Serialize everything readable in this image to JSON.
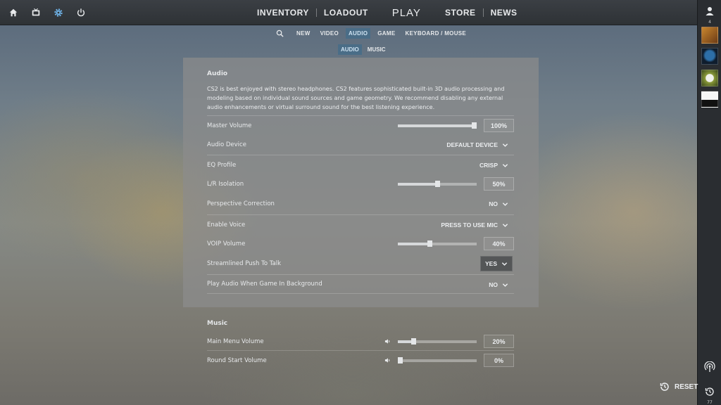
{
  "topbar": {
    "icons": [
      "home-icon",
      "tv-icon",
      "settings-gear-icon",
      "power-icon"
    ],
    "nav": {
      "inventory": "INVENTORY",
      "loadout": "LOADOUT",
      "play": "PLAY",
      "store": "STORE",
      "news": "NEWS"
    }
  },
  "subnav": {
    "tabs": [
      "NEW",
      "VIDEO",
      "AUDIO",
      "GAME",
      "KEYBOARD / MOUSE"
    ],
    "active": "AUDIO",
    "subtabs": [
      "AUDIO",
      "MUSIC"
    ],
    "active_subtab": "AUDIO"
  },
  "audio": {
    "title": "Audio",
    "description": "CS2 is best enjoyed with stereo headphones. CS2 features sophisticated built-in 3D audio processing and modeling based on individual sound sources and game geometry. We recommend disabling any external audio enhancements or virtual surround sound for the best listening experience.",
    "master_volume": {
      "label": "Master Volume",
      "value": "100%",
      "level": 1.0
    },
    "audio_device": {
      "label": "Audio Device",
      "value": "DEFAULT DEVICE"
    },
    "eq_profile": {
      "label": "EQ Profile",
      "value": "CRISP"
    },
    "lr_isolation": {
      "label": "L/R Isolation",
      "value": "50%",
      "level": 0.5
    },
    "perspective_correction": {
      "label": "Perspective Correction",
      "value": "NO"
    },
    "enable_voice": {
      "label": "Enable Voice",
      "value": "PRESS TO USE MIC"
    },
    "voip_volume": {
      "label": "VOIP Volume",
      "value": "40%",
      "level": 0.4
    },
    "streamlined_ptt": {
      "label": "Streamlined Push To Talk",
      "value": "YES"
    },
    "play_in_background": {
      "label": "Play Audio When Game In Background",
      "value": "NO"
    }
  },
  "music": {
    "title": "Music",
    "main_menu_volume": {
      "label": "Main Menu Volume",
      "value": "20%",
      "level": 0.2
    },
    "round_start_volume": {
      "label": "Round Start Volume",
      "value": "0%",
      "level": 0.0
    }
  },
  "rightbar": {
    "friends_count": "4",
    "bottom_count": "77"
  },
  "reset_label": "RESET",
  "colors": {
    "accent_tab": "#4a6d87",
    "panel": "#8c8c8c",
    "topbar": "#2e3236"
  }
}
